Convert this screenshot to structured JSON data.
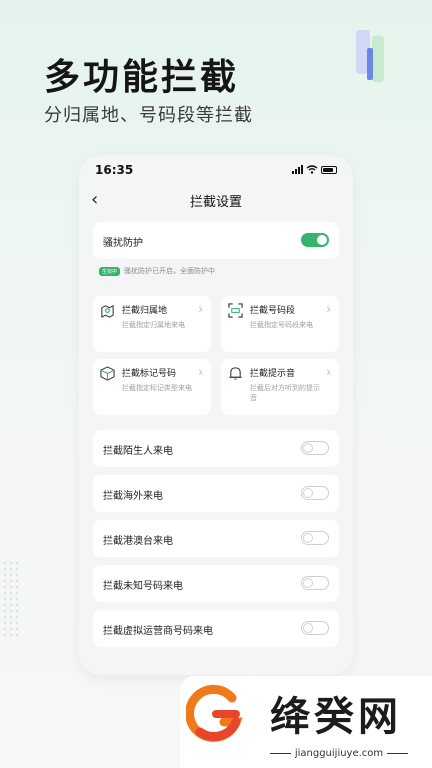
{
  "hero": {
    "title": "多功能拦截",
    "subtitle": "分归属地、号码段等拦截"
  },
  "status_bar": {
    "time": "16:35"
  },
  "nav": {
    "title": "拦截设置"
  },
  "harass": {
    "label": "骚扰防护",
    "enabled": true,
    "badge": "生效中",
    "status": "骚扰防护已开启，全面防护中"
  },
  "features": [
    {
      "title": "拦截归属地",
      "desc": "拦截指定归属地来电",
      "icon": "map-pin-icon"
    },
    {
      "title": "拦截号码段",
      "desc": "拦截指定号码段来电",
      "icon": "scan-icon"
    },
    {
      "title": "拦截标记号码",
      "desc": "拦截指定标记类型来电",
      "icon": "cube-icon"
    },
    {
      "title": "拦截提示音",
      "desc": "拦截后对方听到的提示音",
      "icon": "bell-icon"
    }
  ],
  "toggles": [
    {
      "label": "拦截陌生人来电",
      "enabled": false
    },
    {
      "label": "拦截海外来电",
      "enabled": false
    },
    {
      "label": "拦截港澳台来电",
      "enabled": false
    },
    {
      "label": "拦截未知号码来电",
      "enabled": false
    },
    {
      "label": "拦截虚拟运营商号码来电",
      "enabled": false
    }
  ],
  "brand": {
    "name": "绛癸网",
    "url": "jiangguijiuye.com"
  },
  "colors": {
    "accent": "#35b46b",
    "brand_orange": "#f07a1a",
    "brand_red": "#e8452c"
  }
}
